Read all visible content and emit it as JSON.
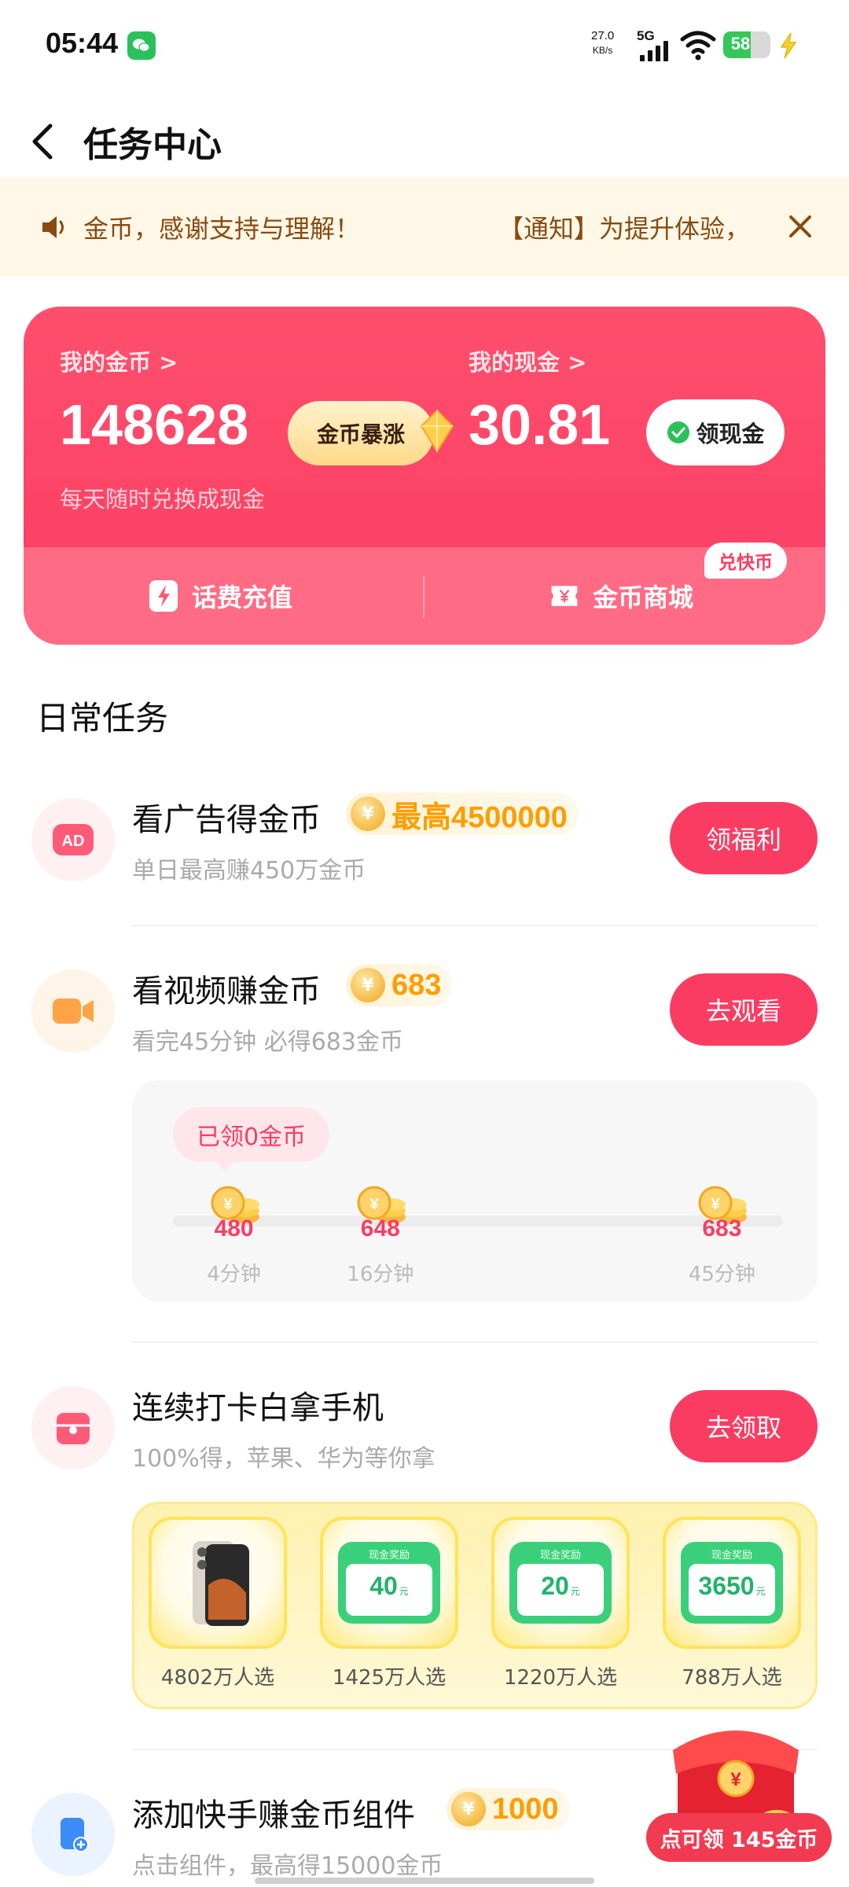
{
  "status_bar": {
    "time": "05:44",
    "net_speed_value": "27.0",
    "net_speed_unit": "KB/s",
    "network": "5G",
    "battery": "58"
  },
  "header": {
    "title": "任务中心"
  },
  "notice": {
    "text_left": "金币，感谢支持与理解！",
    "text_right": "【通知】为提升体验，"
  },
  "coin_card": {
    "coin_label": "我的金币 >",
    "coin_value": "148628",
    "surge_label": "金币暴涨",
    "cash_label": "我的现金 >",
    "cash_value": "30.81",
    "withdraw_label": "领现金",
    "subtitle": "每天随时兑换成现金",
    "phone_recharge": "话费充值",
    "coin_mall": "金币商城",
    "exchange_badge": "兑快币"
  },
  "daily_section": {
    "title": "日常任务"
  },
  "tasks": [
    {
      "title": "看广告得金币",
      "reward": "最高4500000",
      "subtitle": "单日最高赚450万金币",
      "button": "领福利",
      "icon": "ad-icon"
    },
    {
      "title": "看视频赚金币",
      "reward": "683",
      "subtitle": "看完45分钟 必得683金币",
      "button": "去观看",
      "icon": "video-camera-icon"
    },
    {
      "title": "连续打卡白拿手机",
      "subtitle": "100%得，苹果、华为等你拿",
      "button": "去领取",
      "icon": "gift-box-icon"
    },
    {
      "title": "添加快手赚金币组件",
      "reward": "1000",
      "subtitle": "点击组件，最高得15000金币",
      "icon": "widget-add-icon"
    }
  ],
  "video_progress": {
    "claimed": "已领0金币",
    "milestones": [
      {
        "value": "480",
        "time": "4分钟",
        "minutes": 4
      },
      {
        "value": "648",
        "time": "16分钟",
        "minutes": 16
      },
      {
        "value": "683",
        "time": "45分钟",
        "minutes": 45
      }
    ]
  },
  "phone_rewards": {
    "card_label": "现金奖励",
    "unit": "元",
    "items": [
      {
        "type": "phone",
        "count": "4802万人选"
      },
      {
        "type": "cash",
        "amount": "40",
        "count": "1425万人选"
      },
      {
        "type": "cash",
        "amount": "20",
        "count": "1220万人选"
      },
      {
        "type": "cash",
        "amount": "3650",
        "count": "788万人选"
      }
    ]
  },
  "floating_reward": {
    "label": "点可领 145金币"
  },
  "colors": {
    "primary": "#fb3c62",
    "coin_gold": "#ff9d00",
    "notice_bg": "#fff8e6",
    "cash_green": "#3ad07b"
  }
}
